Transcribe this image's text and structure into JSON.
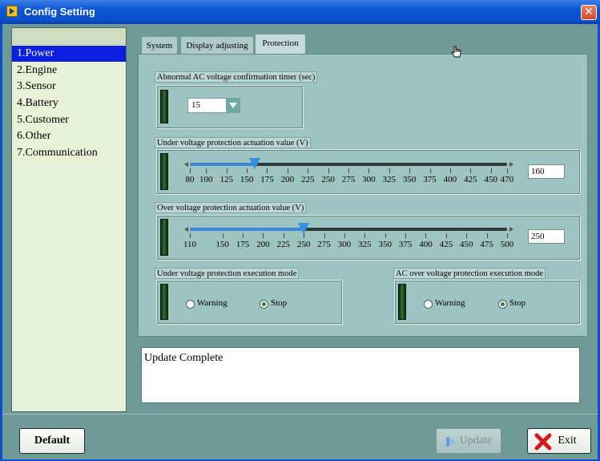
{
  "window": {
    "title": "Config Setting",
    "close_glyph": "✕"
  },
  "sidebar": {
    "items": [
      {
        "label": "1.Power",
        "selected": true
      },
      {
        "label": "2.Engine"
      },
      {
        "label": "3.Sensor"
      },
      {
        "label": "4.Battery"
      },
      {
        "label": "5.Customer"
      },
      {
        "label": "6.Other"
      },
      {
        "label": "7.Communication"
      }
    ]
  },
  "tabs": [
    {
      "label": "System"
    },
    {
      "label": "Display adjusting"
    },
    {
      "label": "Protection",
      "active": true
    }
  ],
  "protection": {
    "ac_timer": {
      "label": "Abnormal AC voltage confirmation timer (sec)",
      "value": "15"
    },
    "under_voltage": {
      "label": "Under voltage protection actuation value (V)",
      "value": "160",
      "ticks": [
        "80",
        "100",
        "125",
        "150",
        "175",
        "200",
        "225",
        "250",
        "275",
        "300",
        "325",
        "350",
        "375",
        "400",
        "425",
        "450",
        "470"
      ],
      "min": 80,
      "max": 470,
      "current": 160
    },
    "over_voltage": {
      "label": "Over voltage protection actuation value (V)",
      "value": "250",
      "ticks": [
        "110",
        "150",
        "175",
        "200",
        "225",
        "250",
        "275",
        "300",
        "325",
        "350",
        "375",
        "400",
        "425",
        "450",
        "475",
        "500"
      ],
      "min": 110,
      "max": 500,
      "current": 250
    },
    "under_mode": {
      "label": "Under voltage protection execution mode",
      "warning": "Warning",
      "stop": "Stop",
      "selected": "Stop"
    },
    "over_mode": {
      "label": "AC over voltage protection execution mode",
      "warning": "Warning",
      "stop": "Stop",
      "selected": "Stop"
    }
  },
  "status": {
    "text": "Update Complete"
  },
  "buttons": {
    "default": "Default",
    "update": "Update",
    "exit": "Exit"
  },
  "colors": {
    "accent": "#0a1fe0",
    "slider_fill": "#3d86d8",
    "panel": "#9ec4c2"
  }
}
